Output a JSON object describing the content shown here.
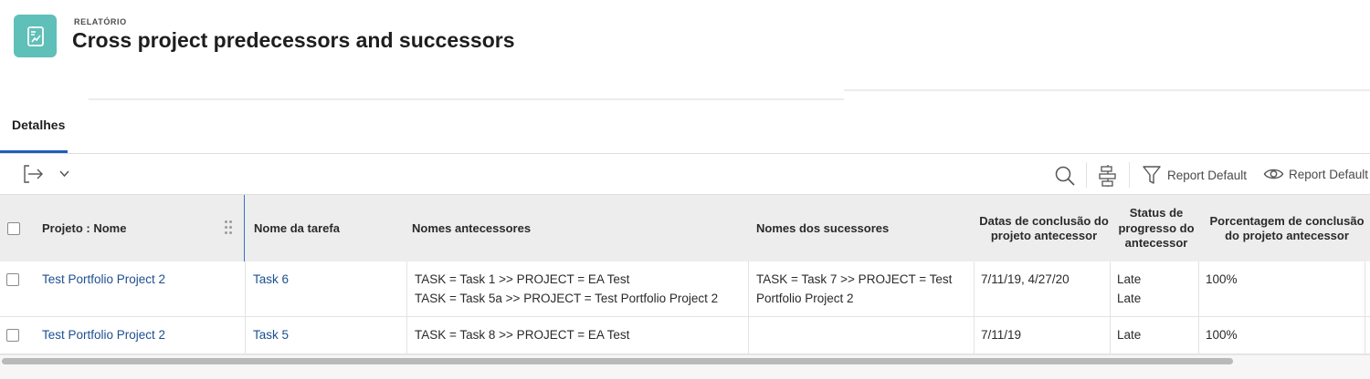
{
  "header": {
    "eyebrow": "RELATÓRIO",
    "title": "Cross project predecessors and successors"
  },
  "tabs": [
    {
      "label": "Detalhes",
      "active": true
    }
  ],
  "toolbar": {
    "export_icon": "export-icon",
    "filter_label": "Report Default",
    "view_label": "Report Default"
  },
  "table": {
    "columns": [
      "Projeto : Nome",
      "Nome da tarefa",
      "Nomes antecessores",
      "Nomes dos sucessores",
      "Datas de conclusão do projeto antecessor",
      "Status de progresso do antecessor",
      "Porcentagem de conclusão do projeto antecessor"
    ],
    "rows": [
      {
        "project": "Test Portfolio Project 2",
        "task": "Task 6",
        "predecessors": [
          "TASK = Task 1 >> PROJECT = EA Test",
          "TASK = Task 5a >> PROJECT = Test Portfolio Project 2"
        ],
        "successors": [
          "TASK = Task 7 >> PROJECT = Test",
          "Portfolio Project 2"
        ],
        "completion_dates": "7/11/19, 4/27/20",
        "status": [
          "Late",
          "Late"
        ],
        "percent": "100%"
      },
      {
        "project": "Test Portfolio Project 2",
        "task": "Task 5",
        "predecessors": [
          "TASK = Task 8 >> PROJECT = EA Test"
        ],
        "successors": [],
        "completion_dates": "7/11/19",
        "status": [
          "Late"
        ],
        "percent": "100%"
      }
    ]
  },
  "colors": {
    "app_icon_bg": "#5fbfb9",
    "link": "#1d4f91",
    "tab_underline": "#1f5fbf"
  }
}
